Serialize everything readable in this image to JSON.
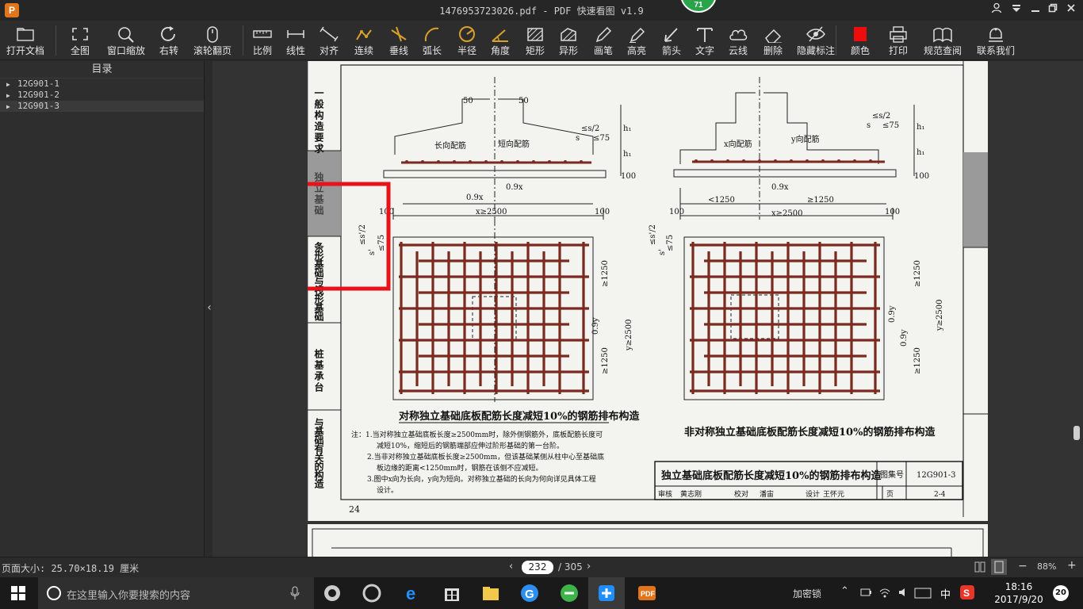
{
  "window": {
    "title": "1476953723026.pdf - PDF 快速看图 v1.9",
    "logo_letter": "P",
    "badge": "71"
  },
  "toolbar": [
    {
      "name": "open-document",
      "label": "打开文档",
      "icon": "folder-icon"
    },
    {
      "name": "fit-all",
      "label": "全图",
      "icon": "fullscreen-icon"
    },
    {
      "name": "window-zoom",
      "label": "窗口缩放",
      "icon": "magnifier-icon"
    },
    {
      "name": "rotate-right",
      "label": "右转",
      "icon": "rotate-icon"
    },
    {
      "name": "wheel-page",
      "label": "滚轮翻页",
      "icon": "mouse-icon"
    },
    {
      "name": "scale",
      "label": "比例",
      "icon": "ruler-icon"
    },
    {
      "name": "linear",
      "label": "线性",
      "icon": "linear-icon"
    },
    {
      "name": "align",
      "label": "对齐",
      "icon": "align-icon"
    },
    {
      "name": "continuous",
      "label": "连续",
      "icon": "continuous-icon"
    },
    {
      "name": "perpendicular",
      "label": "垂线",
      "icon": "perpendicular-icon"
    },
    {
      "name": "arc-length",
      "label": "弧长",
      "icon": "arc-icon"
    },
    {
      "name": "radius",
      "label": "半径",
      "icon": "radius-icon"
    },
    {
      "name": "angle",
      "label": "角度",
      "icon": "angle-icon"
    },
    {
      "name": "rectangle",
      "label": "矩形",
      "icon": "rectangle-icon"
    },
    {
      "name": "irregular",
      "label": "异形",
      "icon": "irregular-icon"
    },
    {
      "name": "pen",
      "label": "画笔",
      "icon": "pen-icon"
    },
    {
      "name": "highlight",
      "label": "高亮",
      "icon": "highlighter-icon"
    },
    {
      "name": "arrow",
      "label": "箭头",
      "icon": "arrow-icon"
    },
    {
      "name": "text",
      "label": "文字",
      "icon": "text-icon"
    },
    {
      "name": "cloud-line",
      "label": "云线",
      "icon": "cloud-icon"
    },
    {
      "name": "delete",
      "label": "删除",
      "icon": "eraser-icon"
    },
    {
      "name": "hide-annotations",
      "label": "隐藏标注",
      "icon": "eye-slash-icon"
    },
    {
      "name": "color",
      "label": "颜色",
      "icon": "color-swatch-icon"
    },
    {
      "name": "print",
      "label": "打印",
      "icon": "printer-icon"
    },
    {
      "name": "spec-lookup",
      "label": "规范查阅",
      "icon": "book-icon"
    },
    {
      "name": "contact-us",
      "label": "联系我们",
      "icon": "contact-icon"
    }
  ],
  "sidebar": {
    "title": "目录",
    "items": [
      "12G901-1",
      "12G901-2",
      "12G901-3"
    ],
    "selected_index": 2
  },
  "document": {
    "side_tabs": [
      "一般构造要求",
      "独立基础",
      "条形基础与筏形基础",
      "桩基承台",
      "与基础有关的构造"
    ],
    "left_diagram": {
      "dims_top": [
        "50",
        "50"
      ],
      "rebar_labels": [
        "长向配筋",
        "短向配筋"
      ],
      "side_dims": [
        "≤s/2",
        "s",
        "≤75",
        "h₁",
        "h₁",
        "100"
      ],
      "bottom_dims": [
        "0.9x",
        "0.9x",
        "x≥2500",
        "100",
        "100"
      ],
      "plan_dims": [
        "≥1250",
        "≥1250",
        "0.9y",
        "y≥2500"
      ],
      "plan_side": [
        "≤s'/2",
        "s'",
        "≤75"
      ],
      "caption": "对称独立基础底板配筋长度减短10%的钢筋排布构造"
    },
    "right_diagram": {
      "rebar_labels": [
        "x向配筋",
        "y向配筋"
      ],
      "side_dims": [
        "≤s/2",
        "s",
        "≤75",
        "h₁",
        "h₁",
        "100"
      ],
      "bottom_dims": [
        "0.9x",
        "<1250",
        "≥1250",
        "x≥2500",
        "100",
        "100"
      ],
      "plan_dims": [
        "≥1250",
        "≥1250",
        "0.9y",
        "0.9y",
        "y≥2500"
      ],
      "plan_side": [
        "≤s'/2",
        "s'",
        "≤75"
      ],
      "caption": "非对称独立基础底板配筋长度减短10%的钢筋排布构造"
    },
    "notes": [
      "注：1.当对称独立基础底板长度≥2500mm时，除外侧钢筋外，底板配筋长度可",
      "减短10%，缩短后的钢筋端部应伸过阶形基础的第一台阶。",
      "2.当非对称独立基础底板长度≥2500mm，但该基础某侧从柱中心至基础底",
      "板边缘的距离<1250mm时，钢筋在该侧不应减短。",
      "3.图中x向为长向，y向为短向。对称独立基础的长向为何向详见具体工程",
      "设计。"
    ],
    "title_block": {
      "title": "独立基础底板配筋长度减短10%的钢筋排布构造",
      "atlas_label": "图集号",
      "atlas_no": "12G901-3",
      "row2": [
        "审核",
        "黄志刚",
        "校对",
        "潘宙",
        "设计",
        "王怀元",
        "页",
        "2-4"
      ]
    },
    "page_number": "24"
  },
  "statusbar": {
    "page_size": "页面大小: 25.70×18.19 厘米",
    "current_page": "232",
    "total_pages": "/ 305",
    "zoom": "88%"
  },
  "taskbar": {
    "search_placeholder": "在这里输入你要搜索的内容",
    "time": "18:16",
    "date": "2017/9/20",
    "ime": "中",
    "notifications": "20",
    "tray_text": "加密锁"
  },
  "colors": {
    "rebar": "#7a2a1e",
    "highlight_box": "#e6141a",
    "sidebar_selected": "#3a3a3a"
  }
}
